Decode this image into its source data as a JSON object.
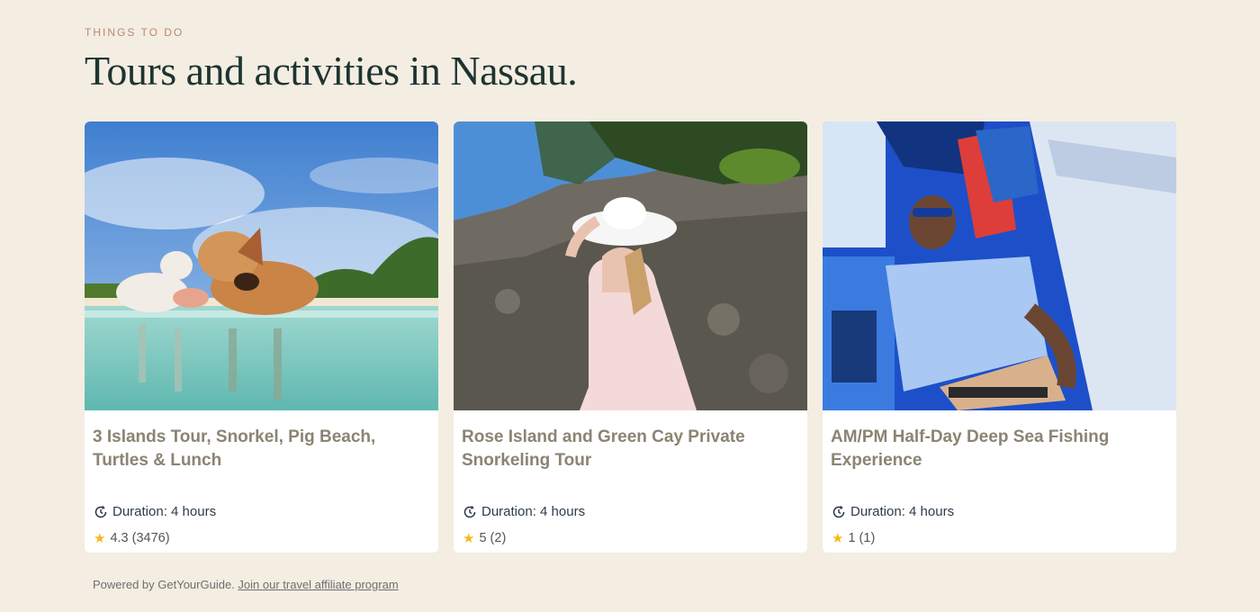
{
  "section": {
    "eyebrow": "THINGS TO DO",
    "heading": "Tours and activities in Nassau."
  },
  "cards": [
    {
      "title": "3 Islands Tour, Snorkel, Pig Beach, Turtles & Lunch",
      "duration": "Duration: 4 hours",
      "rating": "4.3 (3476)",
      "image": "swimming-pigs-beach-photo"
    },
    {
      "title": "Rose Island and Green Cay Private Snorkeling Tour",
      "duration": "Duration: 4 hours",
      "rating": "5 (2)",
      "image": "woman-hat-rocky-shore-photo"
    },
    {
      "title": "AM/PM Half-Day Deep Sea Fishing Experience",
      "duration": "Duration: 4 hours",
      "rating": "1 (1)",
      "image": "man-relaxing-boat-photo"
    }
  ],
  "footer": {
    "prefix": "Powered by GetYourGuide.",
    "link": "Join our travel affiliate program"
  },
  "icons": {
    "duration": "clock-icon",
    "rating": "star-icon"
  },
  "colors": {
    "background": "#f4ede2",
    "heading": "#1d3431",
    "eyebrow": "#b98a73",
    "card_title": "#8a8472",
    "star": "#f6b820"
  }
}
